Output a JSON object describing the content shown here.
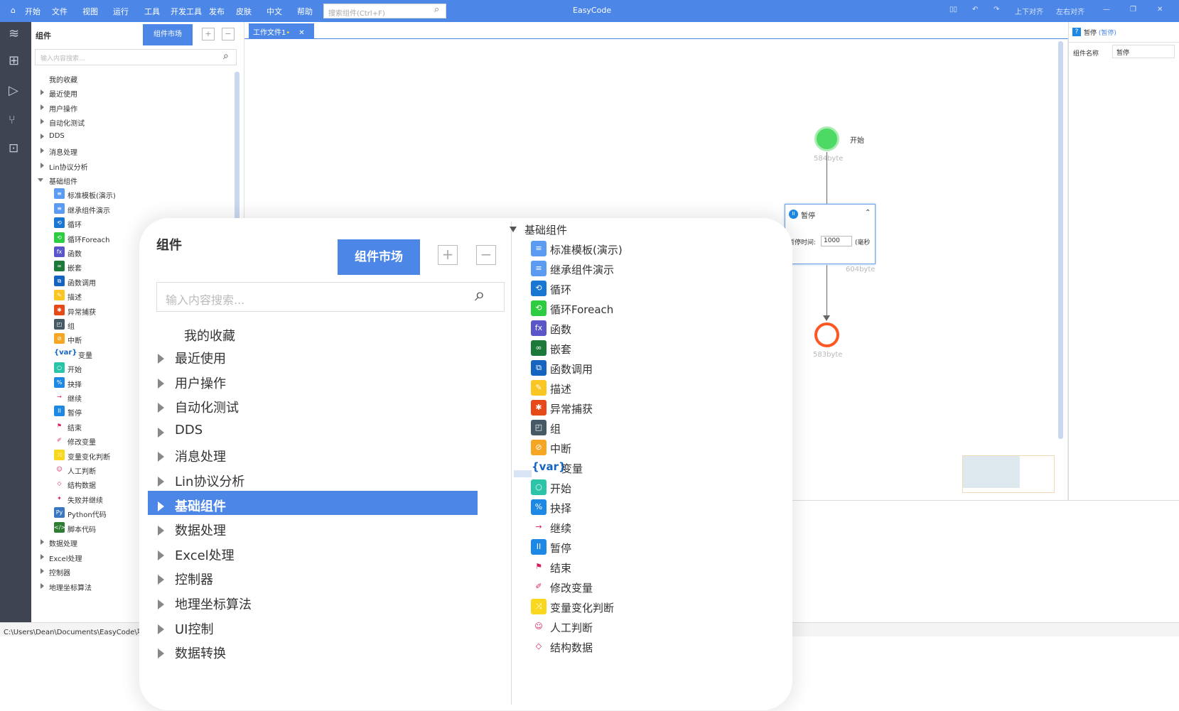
{
  "app": {
    "title": "EasyCode",
    "menu": [
      "开始",
      "文件",
      "视图",
      "运行",
      "工具",
      "开发工具",
      "发布",
      "皮肤",
      "中文",
      "帮助"
    ],
    "search_placeholder": "搜索组件(Ctrl+F)",
    "right_tools": [
      "上下对齐",
      "左右对齐"
    ]
  },
  "panel": {
    "title": "组件",
    "market_button": "组件市场",
    "search_placeholder": "输入内容搜索...",
    "favorites": "我的收藏",
    "categories_top": [
      "最近使用",
      "用户操作",
      "自动化测试",
      "DDS",
      "消息处理",
      "Lin协议分析"
    ],
    "expanded": "基础组件",
    "basic_items": [
      "标准模板(演示)",
      "继承组件演示",
      "循环",
      "循环Foreach",
      "函数",
      "嵌套",
      "函数调用",
      "描述",
      "异常捕获",
      "组",
      "中断",
      "变量",
      "开始",
      "抉择",
      "继续",
      "暂停",
      "结束",
      "修改变量",
      "变量变化判断",
      "人工判断",
      "结构数据",
      "失败并继续",
      "Python代码",
      "脚本代码"
    ],
    "var_prefix": "{var}",
    "categories_bottom": [
      "数据处理",
      "Excel处理",
      "控制器",
      "地理坐标算法"
    ]
  },
  "magnified": {
    "categories": [
      "最近使用",
      "用户操作",
      "自动化测试",
      "DDS",
      "消息处理",
      "Lin协议分析",
      "基础组件",
      "数据处理",
      "Excel处理",
      "控制器",
      "地理坐标算法",
      "UI控制",
      "数据转换"
    ],
    "right_items": [
      "标准模板(演示)",
      "继承组件演示",
      "循环",
      "循环Foreach",
      "函数",
      "嵌套",
      "函数调用",
      "描述",
      "异常捕获",
      "组",
      "中断",
      "变量",
      "开始",
      "抉择",
      "继续",
      "暂停",
      "结束",
      "修改变量",
      "变量变化判断",
      "人工判断",
      "结构数据"
    ]
  },
  "editor": {
    "tab": "工作文件1",
    "start_label": "开始",
    "start_bytes": "584byte",
    "pause_label": "暂停",
    "pause_time_label": "暂停时间:",
    "pause_time_value": "1000",
    "pause_unit": "(毫秒",
    "pause_bytes": "604byte",
    "end_bytes": "583byte"
  },
  "props": {
    "header": "暂停",
    "header_sub": "(暂停)",
    "name_label": "组件名称",
    "name_value": "暂停"
  },
  "status": {
    "path": "C:\\Users\\Dean\\Documents\\EasyCode\\项目"
  },
  "colors": {
    "accent": "#4c86e6",
    "rail": "#3e4451",
    "start": "#4cd964",
    "end": "#ff5722"
  }
}
